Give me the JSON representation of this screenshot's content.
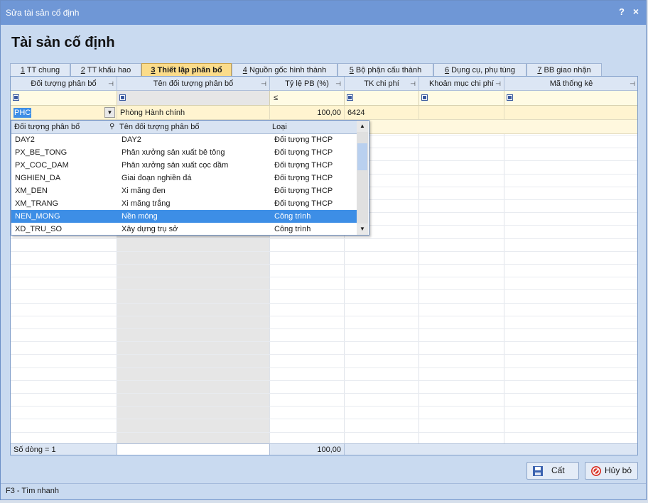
{
  "window": {
    "title": "Sửa tài sản cố định",
    "help": "?",
    "close": "×"
  },
  "heading": "Tài sản cố định",
  "tabs": [
    {
      "key": "1",
      "label": " TT chung"
    },
    {
      "key": "2",
      "label": " TT khấu hao"
    },
    {
      "key": "3",
      "label": " Thiết lập phân bổ"
    },
    {
      "key": "4",
      "label": " Nguồn gốc hình thành"
    },
    {
      "key": "5",
      "label": " Bộ phận cấu thành"
    },
    {
      "key": "6",
      "label": " Dụng cụ, phụ tùng"
    },
    {
      "key": "7",
      "label": " BB giao nhận"
    }
  ],
  "grid": {
    "columns": [
      "Đối tượng phân bổ",
      "Tên đối tượng phân bổ",
      "Tỷ lệ PB (%)",
      "TK chi phí",
      "Khoản mục chi phí",
      "Mã thống kê"
    ],
    "filter_operator": "≤",
    "row": {
      "code": "PHC",
      "name": "Phòng Hành chính",
      "ratio": "100,00",
      "account": "6424"
    },
    "footer": {
      "count": "Số dòng = 1",
      "col2": "Tên đối tượng phân bổ",
      "col3": "Loại",
      "total": "100,00"
    }
  },
  "dropdown": {
    "headers": [
      "Đối tượng phân bổ",
      "Tên đối tượng phân bổ",
      "Loại"
    ],
    "items": [
      {
        "code": "DAY2",
        "name": "DAY2",
        "type": "Đối tượng THCP"
      },
      {
        "code": "PX_BE_TONG",
        "name": "Phân xưởng sản xuất bê tông",
        "type": "Đối tượng THCP"
      },
      {
        "code": "PX_COC_DAM",
        "name": "Phân xưởng sản xuất cọc dầm",
        "type": "Đối tượng THCP"
      },
      {
        "code": "NGHIEN_DA",
        "name": "Giai đoạn nghiền đá",
        "type": "Đối tượng THCP"
      },
      {
        "code": "XM_DEN",
        "name": "Xi măng đen",
        "type": "Đối tượng THCP"
      },
      {
        "code": "XM_TRANG",
        "name": "Xi măng trắng",
        "type": "Đối tượng THCP"
      },
      {
        "code": "NEN_MONG",
        "name": "Nền móng",
        "type": "Công trình"
      },
      {
        "code": "XD_TRU_SO",
        "name": "Xây dựng trụ sở",
        "type": "Công trình"
      }
    ]
  },
  "buttons": {
    "cut": "Cất",
    "cancel": "Hủy bỏ"
  },
  "status": "F3 - Tìm nhanh",
  "colors": {
    "titlebar": "#6f97d6",
    "active_tab": "#fbdc8a",
    "selection": "#3d8ee6"
  }
}
